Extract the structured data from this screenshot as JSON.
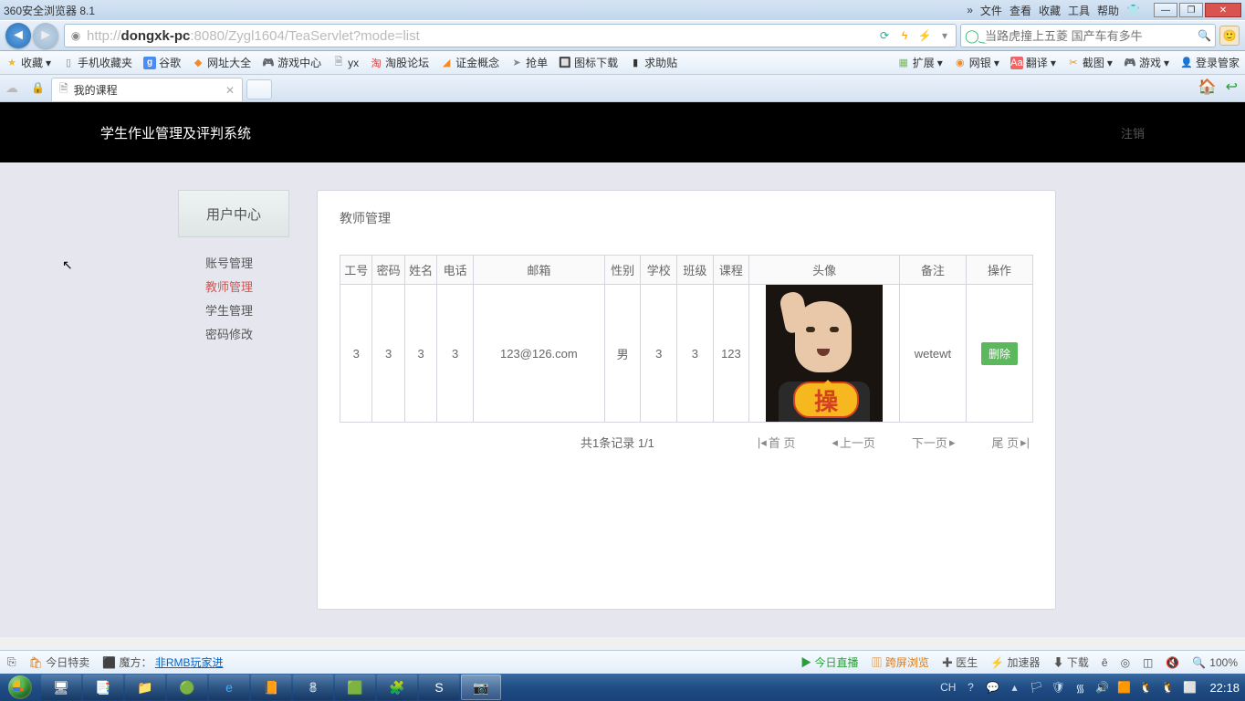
{
  "titlebar": {
    "app_name": "360安全浏览器 8.1",
    "menus": [
      "文件",
      "查看",
      "收藏",
      "工具",
      "帮助"
    ]
  },
  "nav": {
    "url_prefix": "http://",
    "url_host": "dongxk-pc",
    "url_rest": ":8080/Zygl1604/TeaServlet?mode=list",
    "search_placeholder": "当路虎撞上五菱 国产车有多牛"
  },
  "bookmarks": {
    "fav": "收藏",
    "items": [
      "手机收藏夹",
      "谷歌",
      "网址大全",
      "游戏中心",
      "yx",
      "淘股论坛",
      "证金概念",
      "抢单",
      "图标下载",
      "求助贴"
    ],
    "right": [
      "扩展",
      "网银",
      "翻译",
      "截图",
      "游戏",
      "登录管家"
    ]
  },
  "tab": {
    "title": "我的课程"
  },
  "page": {
    "system_title": "学生作业管理及评判系统",
    "logout": "注销"
  },
  "sidebar": {
    "head": "用户中心",
    "items": [
      "账号管理",
      "教师管理",
      "学生管理",
      "密码修改"
    ],
    "active_index": 1
  },
  "panel": {
    "title": "教师管理",
    "headers": [
      "工号",
      "密码",
      "姓名",
      "电话",
      "邮箱",
      "性别",
      "学校",
      "班级",
      "课程",
      "头像",
      "备注",
      "操作"
    ],
    "row": {
      "id": "3",
      "pwd": "3",
      "name": "3",
      "phone": "3",
      "email": "123@126.com",
      "gender": "男",
      "school": "3",
      "class": "3",
      "course": "123",
      "remark": "wetewt",
      "avatar_bubble": "操",
      "delete": "删除"
    },
    "pager": {
      "summary": "共1条记录 1/1",
      "first": "首 页",
      "prev": "上一页",
      "next": "下一页",
      "last": "尾 页"
    }
  },
  "status": {
    "today_sale": "今日特卖",
    "mofang": "魔方：",
    "mofang_link": "非RMB玩家进",
    "today_live": "今日直播",
    "kuapin": "跨屏浏览",
    "doctor": "医生",
    "accel": "加速器",
    "download": "下载",
    "e": "ê",
    "zoom": "100%"
  },
  "taskbar": {
    "lang": "CH",
    "time": "22:18"
  }
}
